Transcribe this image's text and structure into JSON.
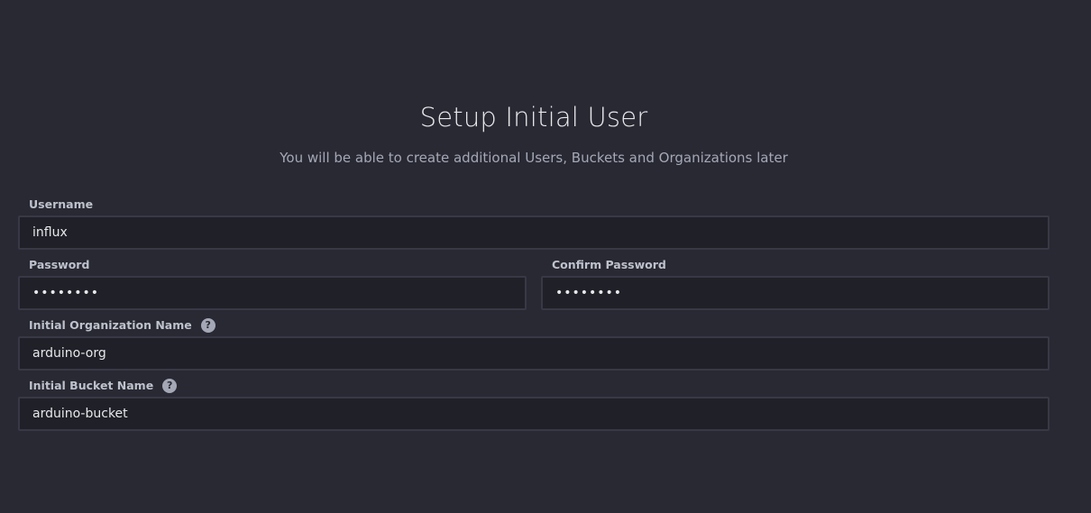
{
  "header": {
    "title": "Setup Initial User",
    "subtitle": "You will be able to create additional Users, Buckets and Organizations later"
  },
  "form": {
    "username": {
      "label": "Username",
      "value": "influx"
    },
    "password": {
      "label": "Password",
      "value": "••••••••"
    },
    "confirm_password": {
      "label": "Confirm Password",
      "value": "••••••••"
    },
    "org_name": {
      "label": "Initial Organization Name",
      "value": "arduino-org",
      "help_icon": "question-circle-icon"
    },
    "bucket_name": {
      "label": "Initial Bucket Name",
      "value": "arduino-bucket",
      "help_icon": "question-circle-icon"
    }
  },
  "colors": {
    "background": "#292933",
    "input_background": "#202028",
    "input_border": "#383846",
    "text_primary": "#e7e8eb",
    "text_secondary": "#a4a8b6"
  }
}
